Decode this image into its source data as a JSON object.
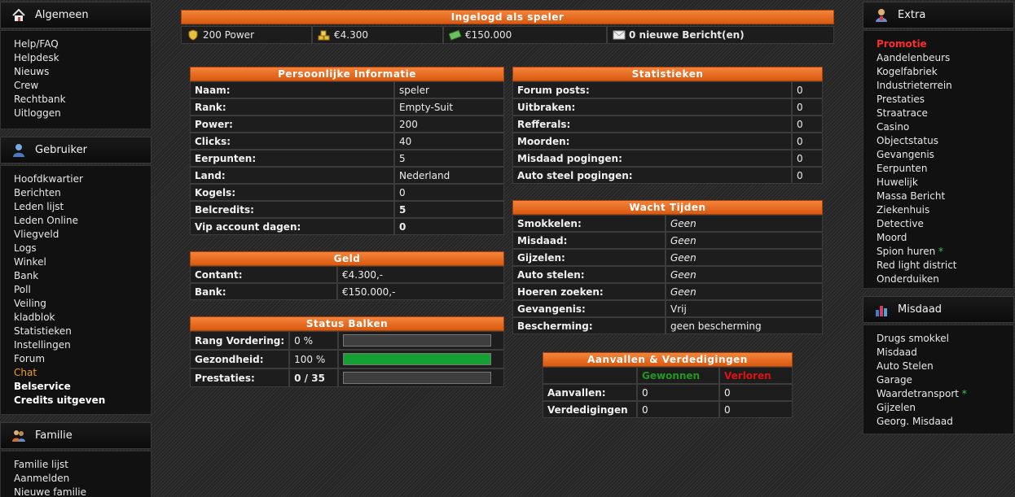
{
  "menus": {
    "algemeen": {
      "title": "Algemeen",
      "items": [
        "Help/FAQ",
        "Helpdesk",
        "Nieuws",
        "Crew",
        "Rechtbank",
        "Uitloggen"
      ]
    },
    "gebruiker": {
      "title": "Gebruiker",
      "items": [
        "Hoofdkwartier",
        "Berichten",
        "Leden lijst",
        "Leden Online",
        "Vliegveld",
        "Logs",
        "Winkel",
        "Bank",
        "Poll",
        "Veiling",
        "kladblok",
        "Statistieken",
        "Instellingen",
        "Forum",
        "Chat",
        "Belservice",
        "Credits uitgeven"
      ]
    },
    "familie": {
      "title": "Familie",
      "items": [
        "Familie lijst",
        "Aanmelden",
        "Nieuwe familie"
      ]
    },
    "extra": {
      "title": "Extra",
      "items": [
        "Promotie",
        "Aandelenbeurs",
        "Kogelfabriek",
        "Industrieterrein",
        "Prestaties",
        "Straatrace",
        "Casino",
        "Objectstatus",
        "Gevangenis",
        "Eerpunten",
        "Huwelijk",
        "Massa Bericht",
        "Ziekenhuis",
        "Detective",
        "Moord",
        "Spion huren",
        "Red light district",
        "Onderduiken"
      ]
    },
    "misdaad": {
      "title": "Misdaad",
      "items": [
        "Drugs smokkel",
        "Misdaad",
        "Auto Stelen",
        "Garage",
        "Waardetransport",
        "Gijzelen",
        "Georg. Misdaad"
      ]
    },
    "star": "*"
  },
  "top": {
    "title": "Ingelogd als speler",
    "power": "200 Power",
    "cash": "€4.300",
    "bank": "€150.000",
    "messages": "0 nieuwe Bericht(en)"
  },
  "personal": {
    "title": "Persoonlijke Informatie",
    "rows": [
      [
        "Naam:",
        "speler"
      ],
      [
        "Rank:",
        "Empty-Suit"
      ],
      [
        "Power:",
        "200"
      ],
      [
        "Clicks:",
        "40"
      ],
      [
        "Eerpunten:",
        "5"
      ],
      [
        "Land:",
        "Nederland"
      ],
      [
        "Kogels:",
        "0"
      ],
      [
        "Belcredits:",
        "5"
      ],
      [
        "Vip account dagen:",
        "0"
      ]
    ]
  },
  "geld": {
    "title": "Geld",
    "rows": [
      [
        "Contant:",
        "€4.300,-"
      ],
      [
        "Bank:",
        "€150.000,-"
      ]
    ]
  },
  "status": {
    "title": "Status Balken",
    "rows": [
      {
        "label": "Rang Vordering:",
        "value": "0 %",
        "fill": 0
      },
      {
        "label": "Gezondheid:",
        "value": "100 %",
        "fill": 1.0
      },
      {
        "label": "Prestaties:",
        "value": "0 / 35",
        "fill": 0
      }
    ]
  },
  "stats": {
    "title": "Statistieken",
    "rows": [
      [
        "Forum posts:",
        "0"
      ],
      [
        "Uitbraken:",
        "0"
      ],
      [
        "Refferals:",
        "0"
      ],
      [
        "Moorden:",
        "0"
      ],
      [
        "Misdaad pogingen:",
        "0"
      ],
      [
        "Auto steel pogingen:",
        "0"
      ]
    ]
  },
  "wait": {
    "title": "Wacht Tijden",
    "rows": [
      [
        "Smokkelen:",
        "Geen"
      ],
      [
        "Misdaad:",
        "Geen"
      ],
      [
        "Gijzelen:",
        "Geen"
      ],
      [
        "Auto stelen:",
        "Geen"
      ],
      [
        "Hoeren zoeken:",
        "Geen"
      ],
      [
        "Gevangenis:",
        "Vrij"
      ],
      [
        "Bescherming:",
        "geen bescherming"
      ]
    ]
  },
  "attack": {
    "title": "Aanvallen & Verdedigingen",
    "won": "Gewonnen",
    "lost": "Verloren",
    "rows": [
      [
        "Aanvallen:",
        "0",
        "0"
      ],
      [
        "Verdedigingen",
        "0",
        "0"
      ]
    ]
  },
  "colors": {
    "accent": "#e8661e",
    "won": "#1f9a1f",
    "lost": "#e01010",
    "bar_fill": "#16a034"
  }
}
